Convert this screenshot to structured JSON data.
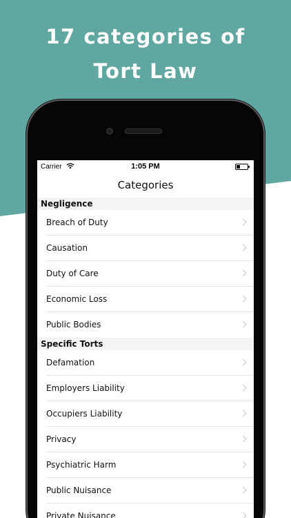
{
  "headline": {
    "line1": "17 categories of",
    "line2": "Tort Law"
  },
  "colors": {
    "background_accent": "#5fa7a0",
    "phone_body": "#060606",
    "section_header_bg": "#f4f4f4",
    "chevron": "#c7c7cc"
  },
  "status_bar": {
    "carrier": "Carrier",
    "time": "1:05 PM",
    "icons": [
      "wifi-icon",
      "battery-icon"
    ]
  },
  "nav": {
    "title": "Categories"
  },
  "sections": [
    {
      "title": "Negligence",
      "items": [
        {
          "label": "Breach of Duty"
        },
        {
          "label": "Causation"
        },
        {
          "label": "Duty of Care"
        },
        {
          "label": "Economic Loss"
        },
        {
          "label": "Public Bodies"
        }
      ]
    },
    {
      "title": "Specific Torts",
      "items": [
        {
          "label": "Defamation"
        },
        {
          "label": "Employers Liability"
        },
        {
          "label": "Occupiers Liability"
        },
        {
          "label": "Privacy"
        },
        {
          "label": "Psychiatric Harm"
        },
        {
          "label": "Public Nuisance"
        },
        {
          "label": "Private Nuisance"
        }
      ]
    }
  ]
}
